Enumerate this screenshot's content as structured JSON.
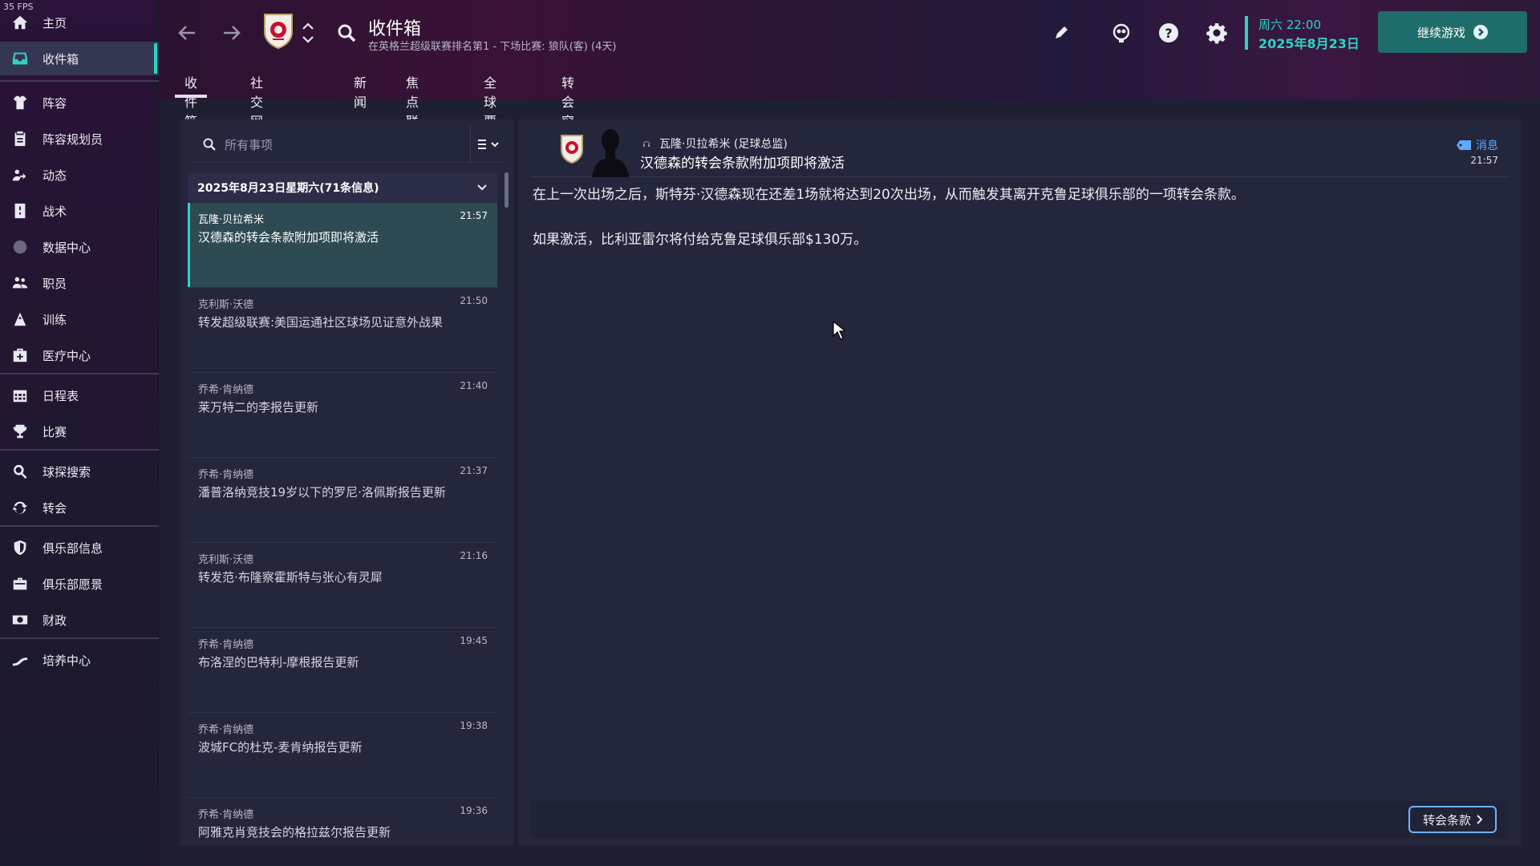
{
  "fps": "35 FPS",
  "sidebar": {
    "items": [
      {
        "label": "主页",
        "icon": "home-icon"
      },
      {
        "label": "收件箱",
        "icon": "inbox-icon",
        "active": true
      },
      {
        "label": "阵容",
        "icon": "squad-icon"
      },
      {
        "label": "阵容规划员",
        "icon": "clipboard-icon"
      },
      {
        "label": "动态",
        "icon": "dynamics-icon"
      },
      {
        "label": "战术",
        "icon": "tactics-icon"
      },
      {
        "label": "数据中心",
        "icon": "data-hub-icon"
      },
      {
        "label": "职员",
        "icon": "staff-icon"
      },
      {
        "label": "训练",
        "icon": "training-icon"
      },
      {
        "label": "医疗中心",
        "icon": "medical-icon"
      },
      {
        "label": "日程表",
        "icon": "calendar-icon"
      },
      {
        "label": "比赛",
        "icon": "trophy-icon"
      },
      {
        "label": "球探搜索",
        "icon": "scouting-search-icon"
      },
      {
        "label": "转会",
        "icon": "transfers-icon"
      },
      {
        "label": "俱乐部信息",
        "icon": "shield-icon"
      },
      {
        "label": "俱乐部愿景",
        "icon": "briefcase-icon"
      },
      {
        "label": "财政",
        "icon": "finances-icon"
      },
      {
        "label": "培养中心",
        "icon": "development-icon"
      }
    ]
  },
  "header": {
    "title": "收件箱",
    "subtitle": "在英格兰超级联赛排名第1 - 下场比赛: 狼队(客) (4天)",
    "date_weekday_time": "周六 22:00",
    "date": "2025年8月23日",
    "continue_label": "继续游戏",
    "tabs": [
      "收件箱",
      "社交网络反馈",
      "新闻",
      "焦点联赛",
      "全球要闻",
      "转会窗口新闻"
    ],
    "active_tab": 0
  },
  "inbox": {
    "search_placeholder": "所有事项",
    "date_group": "2025年8月23日星期六(71条信息)",
    "messages": [
      {
        "sender": "瓦隆·贝拉希米",
        "time": "21:57",
        "subject": "汉德森的转会条款附加项即将激活",
        "selected": true
      },
      {
        "sender": "克利斯·沃德",
        "time": "21:50",
        "subject": "转发超级联赛:美国运通社区球场见证意外战果"
      },
      {
        "sender": "乔希·肯纳德",
        "time": "21:40",
        "subject": "莱万特二的李报告更新"
      },
      {
        "sender": "乔希·肯纳德",
        "time": "21:37",
        "subject": "潘普洛纳竞技19岁以下的罗尼·洛佩斯报告更新"
      },
      {
        "sender": "克利斯·沃德",
        "time": "21:16",
        "subject": "转发范·布隆察霍斯特与张心有灵犀"
      },
      {
        "sender": "乔希·肯纳德",
        "time": "19:45",
        "subject": "布洛涅的巴特利-摩根报告更新"
      },
      {
        "sender": "乔希·肯纳德",
        "time": "19:38",
        "subject": "波城FC的杜克-麦肯纳报告更新"
      },
      {
        "sender": "乔希·肯纳德",
        "time": "19:36",
        "subject": "阿雅克肖竞技会的格拉兹尔报告更新"
      }
    ]
  },
  "message": {
    "sender_role": "瓦隆·贝拉希米 (足球总监)",
    "subject": "汉德森的转会条款附加项即将激活",
    "tag": "消息",
    "time": "21:57",
    "paragraphs": [
      "在上一次出场之后，斯特芬·汉德森现在还差1场就将达到20次出场，从而触发其离开克鲁足球俱乐部的一项转会条款。",
      "如果激活，比利亚雷尔将付给克鲁足球俱乐部$130万。"
    ],
    "footer_button": "转会条款"
  },
  "colors": {
    "accent": "#2fd3c2",
    "continue_button": "#1f6d6a",
    "selected_row": "#2e4a52",
    "link_blue": "#5fa9ff"
  }
}
